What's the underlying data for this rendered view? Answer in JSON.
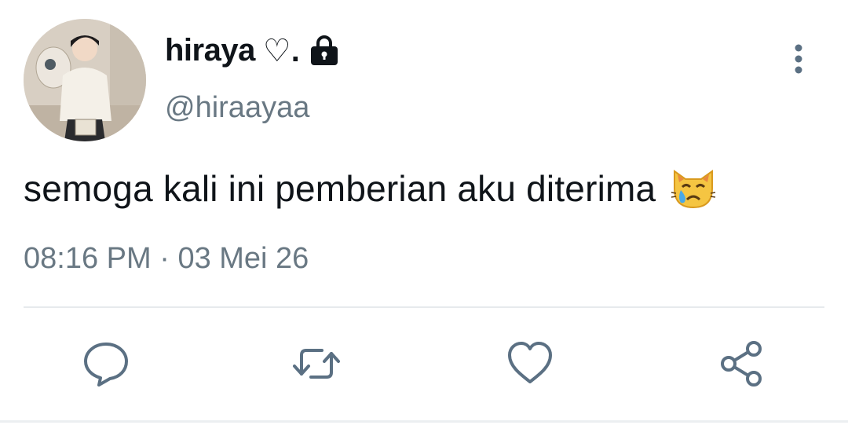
{
  "tweet": {
    "display_name": "hiraya",
    "name_suffix": "♡.",
    "handle": "@hiraayaa",
    "text": "semoga kali ini pemberian aku diterima",
    "emoji": "crying-cat-face",
    "time": "08:16 PM",
    "separator": "·",
    "date": "03 Mei 26"
  },
  "icons": {
    "lock": "lock-icon",
    "more": "more-vertical-icon",
    "reply": "reply-icon",
    "retweet": "retweet-icon",
    "like": "heart-icon",
    "share": "share-icon"
  },
  "colors": {
    "text": "#0f1419",
    "secondary": "#697883",
    "icon": "#5b7083",
    "divider": "#e7eaed"
  }
}
